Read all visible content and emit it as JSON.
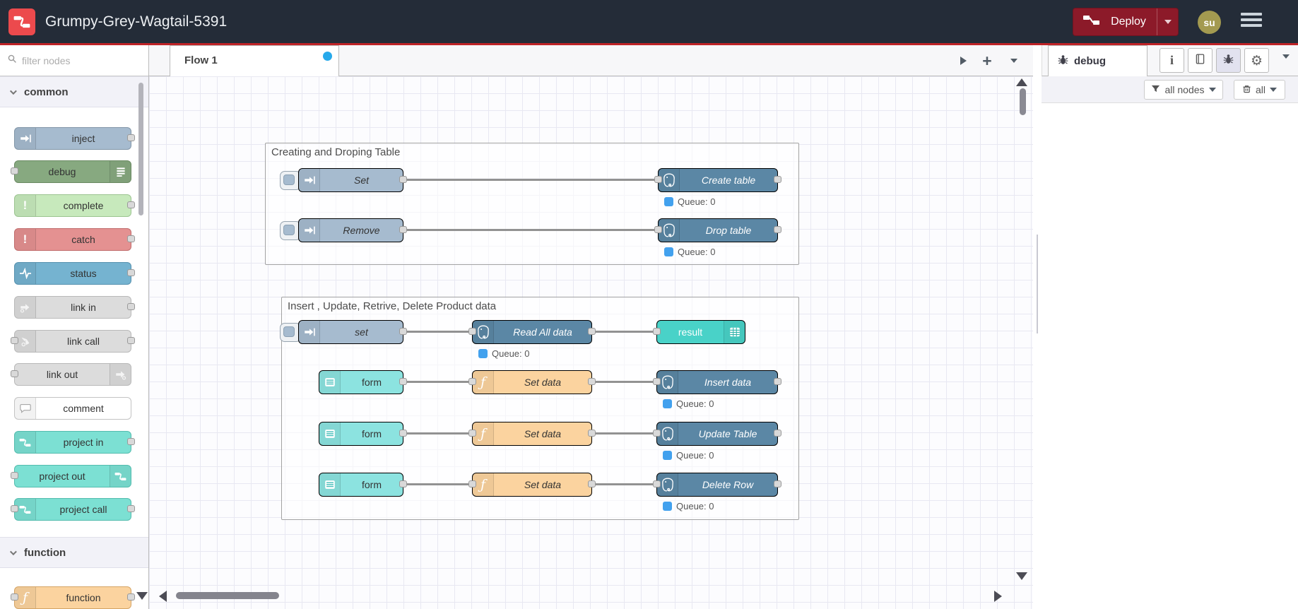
{
  "header": {
    "title": "Grumpy-Grey-Wagtail-5391",
    "deploy": {
      "label": "Deploy"
    },
    "user": {
      "initials": "su"
    }
  },
  "palette": {
    "filter_placeholder": "filter nodes",
    "categories": [
      {
        "label": "common",
        "items": [
          {
            "label": "inject"
          },
          {
            "label": "debug"
          },
          {
            "label": "complete"
          },
          {
            "label": "catch"
          },
          {
            "label": "status"
          },
          {
            "label": "link in"
          },
          {
            "label": "link call"
          },
          {
            "label": "link out"
          },
          {
            "label": "comment"
          },
          {
            "label": "project in"
          },
          {
            "label": "project out"
          },
          {
            "label": "project call"
          }
        ]
      },
      {
        "label": "function",
        "items": [
          {
            "label": "function"
          }
        ]
      }
    ]
  },
  "workspace": {
    "tabs": [
      {
        "label": "Flow 1",
        "modified": true
      }
    ]
  },
  "flow": {
    "groups": [
      {
        "title": "Creating and Droping Table",
        "rows": [
          {
            "source": "Set",
            "target": "Create table",
            "status": "Queue: 0"
          },
          {
            "source": "Remove",
            "target": "Drop table",
            "status": "Queue: 0"
          }
        ]
      },
      {
        "title": "Insert , Update, Retrive, Delete Product data",
        "rows": [
          {
            "source": "set",
            "target": "Read All data",
            "sink": "result",
            "status": "Queue: 0"
          },
          {
            "source": "form",
            "mid": "Set data",
            "target": "Insert data",
            "status": "Queue: 0"
          },
          {
            "source": "form",
            "mid": "Set data",
            "target": "Update Table",
            "status": "Queue: 0"
          },
          {
            "source": "form",
            "mid": "Set data",
            "target": "Delete Row",
            "status": "Queue: 0"
          }
        ]
      }
    ]
  },
  "sidebar": {
    "tab_label": "debug",
    "filters": {
      "nodes_label": "all nodes",
      "clear_label": "all"
    }
  },
  "colors": {
    "header_bg": "#242c38",
    "brand_red": "#bf2327",
    "deploy_bg": "#8c1a29",
    "status_blue": "#42a1ee",
    "node_inject": "#a6bbcf",
    "node_debug": "#87a980",
    "node_complete": "#c7e9bc",
    "node_catch": "#e49191",
    "node_status": "#75b3d0",
    "node_link": "#dcdcdc",
    "node_project": "#7ce0d3",
    "node_function": "#fbd39f",
    "node_postgresql": "#5b87a5",
    "node_form": "#8ce3e0",
    "node_result": "#49d2c8"
  }
}
